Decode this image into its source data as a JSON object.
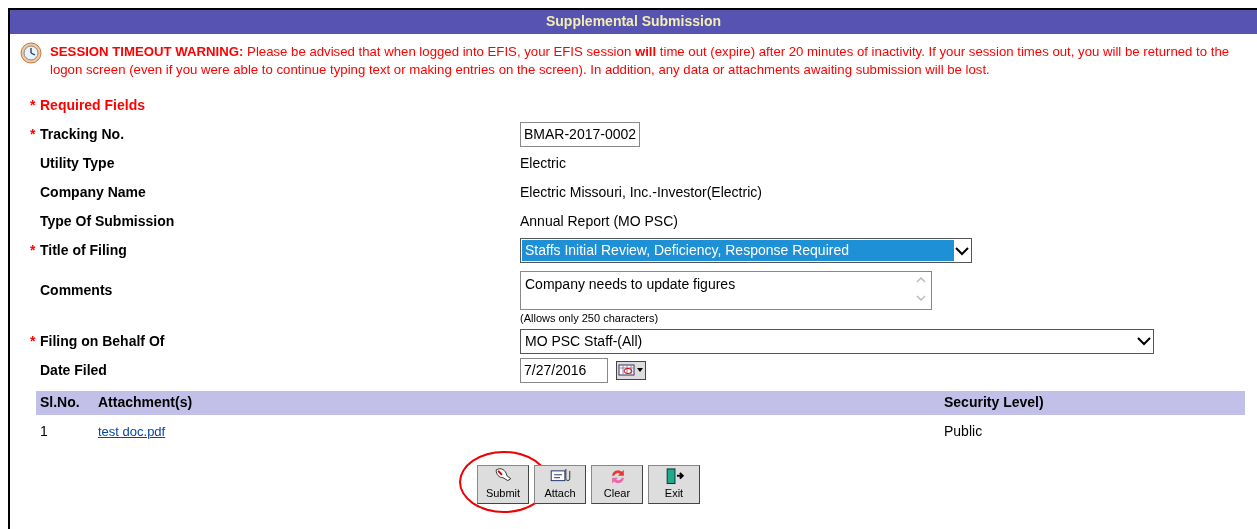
{
  "header": {
    "title": "Supplemental Submission"
  },
  "warning": {
    "text": "**SESSION TIMEOUT WARNING:** Please be advised that when logged into EFIS, your EFIS session **will** time out (expire) after 20 minutes of inactivity. If your session times out, you will be returned to the logon screen (even if you were able to continue typing text or making entries on the screen). In addition, any data or attachments awaiting submission will be lost."
  },
  "required_note": {
    "marker": "*",
    "text": "Required Fields"
  },
  "fields": [
    {
      "kind": "input",
      "marker": "*",
      "label": "Tracking No.",
      "value": "BMAR-2017-0002"
    },
    {
      "kind": "text",
      "label": "Utility Type",
      "value": "Electric"
    },
    {
      "kind": "text",
      "label": "Company Name",
      "value": "Electric Missouri, Inc.-Investor(Electric)"
    },
    {
      "kind": "text",
      "label": "Type Of Submission",
      "value": "Annual Report (MO PSC)"
    },
    {
      "kind": "select",
      "marker": "*",
      "label": "Title of Filing",
      "value": "Staffs Initial Review, Deficiency, Response Required",
      "highlighted": true
    },
    {
      "kind": "textarea",
      "label": "Comments",
      "value": "Company needs to update figures",
      "hint": "(Allows only 250 characters)"
    },
    {
      "kind": "select",
      "marker": "*",
      "label": "Filing on Behalf Of",
      "value": "MO PSC Staff-(All)",
      "highlighted": false,
      "wide": true
    },
    {
      "kind": "date",
      "label": "Date Filed",
      "value": "7/27/2016"
    }
  ],
  "attachments": {
    "columns": [
      "Sl.No.",
      "Attachment(s)",
      "Security Level)"
    ],
    "rows": [
      {
        "no": "1",
        "file": "test doc.pdf",
        "security": "Public"
      }
    ]
  },
  "buttons": [
    {
      "kind": "submit",
      "label": "Submit",
      "circled": true
    },
    {
      "kind": "attach",
      "label": "Attach",
      "circled": false
    },
    {
      "kind": "clear",
      "label": "Clear",
      "circled": false
    },
    {
      "kind": "exit",
      "label": "Exit",
      "circled": false
    }
  ]
}
